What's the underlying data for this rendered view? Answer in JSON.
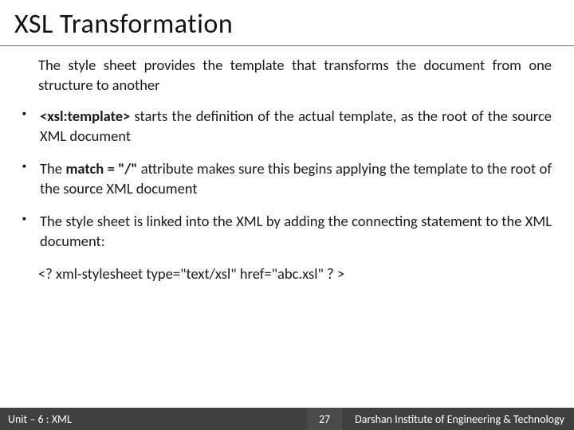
{
  "title": "XSL Transformation",
  "lead": "The style sheet provides the template that transforms the document from one structure to another",
  "bullets": [
    {
      "prefix": "<xsl:template>",
      "rest": " starts the definition of the actual template, as the root of the source XML document"
    },
    {
      "pre": "The ",
      "bold": "match = \"/\"",
      "rest": " attribute makes sure this begins applying the template to the root of the source XML document"
    },
    {
      "text": "The style sheet is linked into the XML by adding the connecting statement to the XML document:"
    }
  ],
  "code_line": "<? xml-stylesheet type=\"text/xsl\" href=\"abc.xsl\" ? >",
  "footer": {
    "unit": "Unit – 6 : XML",
    "page": "27",
    "institute": "Darshan Institute of Engineering & Technology"
  }
}
